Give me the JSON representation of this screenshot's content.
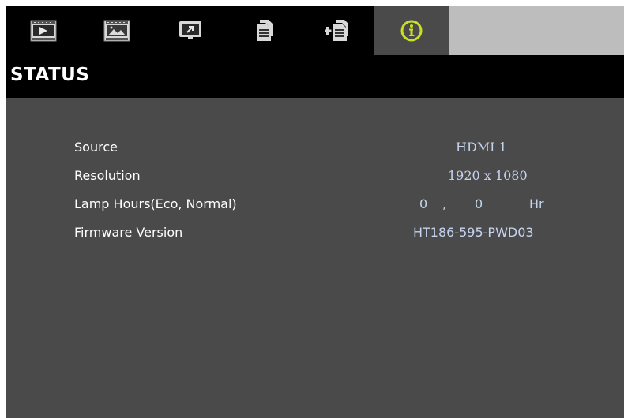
{
  "tabs": [
    {
      "icon": "image-settings-icon",
      "active": false
    },
    {
      "icon": "display-settings-icon",
      "active": false
    },
    {
      "icon": "setup-icon",
      "active": false
    },
    {
      "icon": "options-icon",
      "active": false
    },
    {
      "icon": "advanced-options-icon",
      "active": false
    },
    {
      "icon": "info-icon",
      "active": true
    }
  ],
  "title": "STATUS",
  "status": {
    "source": {
      "label": "Source",
      "value": "HDMI 1"
    },
    "resolution": {
      "label": "Resolution",
      "value": "1920 x 1080"
    },
    "lamp_hours": {
      "label": "Lamp Hours(Eco, Normal)",
      "eco": "0",
      "separator": ",",
      "normal": "0",
      "unit": "Hr"
    },
    "firmware": {
      "label": "Firmware Version",
      "value": "HT186-595-PWD03"
    }
  },
  "colors": {
    "background": "#4a4a4a",
    "bar": "#000000",
    "label": "#ffffff",
    "value": "#c5d4ee",
    "active_icon": "#c8e020"
  }
}
